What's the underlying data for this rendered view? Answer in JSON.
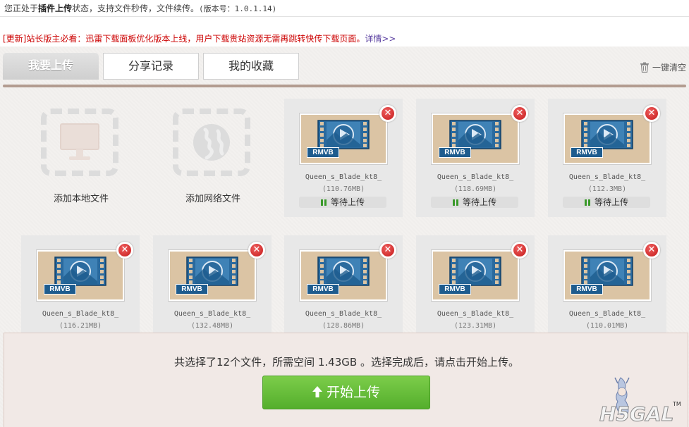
{
  "status": {
    "prefix": "您正处于",
    "mode": "插件上传",
    "suffix": "状态，支持文件秒传，文件续传。",
    "version": "(版本号：1.0.1.14)"
  },
  "notice": {
    "text": "[更新]站长版主必看：迅雷下载面板优化版本上线，用户下载贵站资源无需再跳转快传下载页面。",
    "more": "详情>>"
  },
  "tabs": [
    "我要上传",
    "分享记录",
    "我的收藏"
  ],
  "clear_all": "一键清空",
  "add_local": "添加本地文件",
  "add_network": "添加网络文件",
  "files": [
    {
      "name": "Queen_s_Blade_kt8_",
      "size": "(110.76MB)",
      "status": "等待上传",
      "format": "RMVB"
    },
    {
      "name": "Queen_s_Blade_kt8_",
      "size": "(118.69MB)",
      "status": "等待上传",
      "format": "RMVB"
    },
    {
      "name": "Queen_s_Blade_kt8_",
      "size": "(112.3MB)",
      "status": "等待上传",
      "format": "RMVB"
    },
    {
      "name": "Queen_s_Blade_kt8_",
      "size": "(116.21MB)",
      "status": "",
      "format": "RMVB"
    },
    {
      "name": "Queen_s_Blade_kt8_",
      "size": "(132.48MB)",
      "status": "",
      "format": "RMVB"
    },
    {
      "name": "Queen_s_Blade_kt8_",
      "size": "(128.86MB)",
      "status": "",
      "format": "RMVB"
    },
    {
      "name": "Queen_s_Blade_kt8_",
      "size": "(123.31MB)",
      "status": "",
      "format": "RMVB"
    },
    {
      "name": "Queen_s_Blade_kt8_",
      "size": "(110.01MB)",
      "status": "",
      "format": "RMVB"
    }
  ],
  "footer": {
    "summary": "共选择了12个文件，所需空间 1.43GB 。选择完成后，请点击开始上传。",
    "start_button": "开始上传"
  },
  "logo": {
    "text": "H5GAL",
    "mark": "TM"
  },
  "colors": {
    "accent_green": "#54ae2c",
    "divider": "#b39c90",
    "remove_red": "#c41a1a",
    "film_blue": "#1e5c8e"
  }
}
